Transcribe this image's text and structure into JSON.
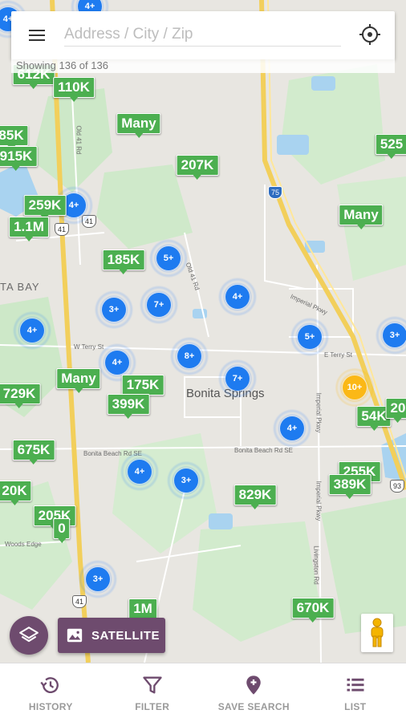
{
  "search": {
    "placeholder": "Address / City / Zip"
  },
  "status": {
    "showing": "Showing 136 of 136"
  },
  "map": {
    "city": "Bonita Springs",
    "area_label": "TA BAY",
    "road_labels": [
      "Old 41 Rd",
      "Old 41 Rd",
      "W Terry St",
      "E Terry St",
      "Bonita Beach Rd SE",
      "Bonita Beach Rd SE",
      "Imperial Pkwy",
      "Imperial Pkwy",
      "Livingston Rd",
      "Woods Edge",
      "Imperial Pkwy"
    ],
    "shields": [
      "41",
      "75",
      "41",
      "93",
      "41"
    ]
  },
  "price_markers": [
    {
      "label": "612K"
    },
    {
      "label": "110K"
    },
    {
      "label": "Many"
    },
    {
      "label": "85K"
    },
    {
      "label": "915K"
    },
    {
      "label": "207K"
    },
    {
      "label": "525"
    },
    {
      "label": "259K"
    },
    {
      "label": "1.1M"
    },
    {
      "label": "Many"
    },
    {
      "label": "185K"
    },
    {
      "label": "Many"
    },
    {
      "label": "175K"
    },
    {
      "label": "399K"
    },
    {
      "label": "729K"
    },
    {
      "label": "54K"
    },
    {
      "label": "20"
    },
    {
      "label": "675K"
    },
    {
      "label": "255K"
    },
    {
      "label": "389K"
    },
    {
      "label": "20K"
    },
    {
      "label": "829K"
    },
    {
      "label": "205K"
    },
    {
      "label": "0"
    },
    {
      "label": "1M"
    },
    {
      "label": "670K"
    }
  ],
  "clusters": [
    {
      "label": "4+"
    },
    {
      "label": "4+"
    },
    {
      "label": "5+"
    },
    {
      "label": "3+"
    },
    {
      "label": "7+"
    },
    {
      "label": "4+"
    },
    {
      "label": "4+"
    },
    {
      "label": "5+"
    },
    {
      "label": "3+"
    },
    {
      "label": "4+"
    },
    {
      "label": "8+"
    },
    {
      "label": "7+"
    },
    {
      "label": "10+"
    },
    {
      "label": "4+"
    },
    {
      "label": "4+"
    },
    {
      "label": "3+"
    },
    {
      "label": "3+"
    },
    {
      "label": "4+"
    }
  ],
  "buttons": {
    "satellite": "SATELLITE"
  },
  "nav": [
    {
      "label": "HISTORY",
      "icon": "history-icon"
    },
    {
      "label": "FILTER",
      "icon": "filter-icon"
    },
    {
      "label": "SAVE SEARCH",
      "icon": "save-search-icon"
    },
    {
      "label": "LIST",
      "icon": "list-icon"
    }
  ],
  "colors": {
    "marker_green": "#4caf50",
    "cluster_blue": "#1e7bf0",
    "cluster_orange": "#fbb816",
    "brand_purple": "#6e4b6e"
  }
}
